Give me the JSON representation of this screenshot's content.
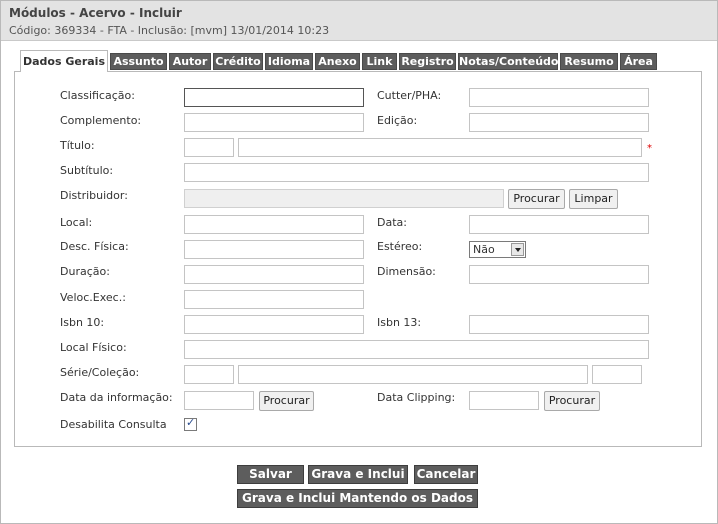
{
  "page": {
    "title": "Módulos - Acervo - Incluir",
    "subtitle": "Código: 369334 - FTA - Inclusão: [mvm] 13/01/2014 10:23"
  },
  "tabs": [
    "Dados Gerais",
    "Assunto",
    "Autor",
    "Crédito",
    "Idioma",
    "Anexo",
    "Link",
    "Registro",
    "Notas/Conteúdo",
    "Resumo",
    "Área"
  ],
  "form": {
    "classificacao": "Classificação:",
    "cutter": "Cutter/PHA:",
    "complemento": "Complemento:",
    "edicao": "Edição:",
    "titulo": "Título:",
    "required_mark": "*",
    "subtitulo": "Subtítulo:",
    "distribuidor": "Distribuidor:",
    "procurar": "Procurar",
    "limpar": "Limpar",
    "local": "Local:",
    "data": "Data:",
    "desc_fisica": "Desc. Física:",
    "estereo": "Estéreo:",
    "estereo_value": "Não",
    "duracao": "Duração:",
    "dimensao": "Dimensão:",
    "veloc": "Veloc.Exec.:",
    "isbn10": "Isbn 10:",
    "isbn13": "Isbn 13:",
    "local_fisico": "Local Físico:",
    "serie": "Série/Coleção:",
    "data_informacao": "Data da informação:",
    "data_clipping": "Data Clipping:",
    "desabilita": "Desabilita Consulta",
    "checkmark": "✓"
  },
  "actions": {
    "salvar": "Salvar",
    "grava_inclui": "Grava e Inclui",
    "cancelar": "Cancelar",
    "grava_mantendo": "Grava e Inclui Mantendo os Dados"
  }
}
